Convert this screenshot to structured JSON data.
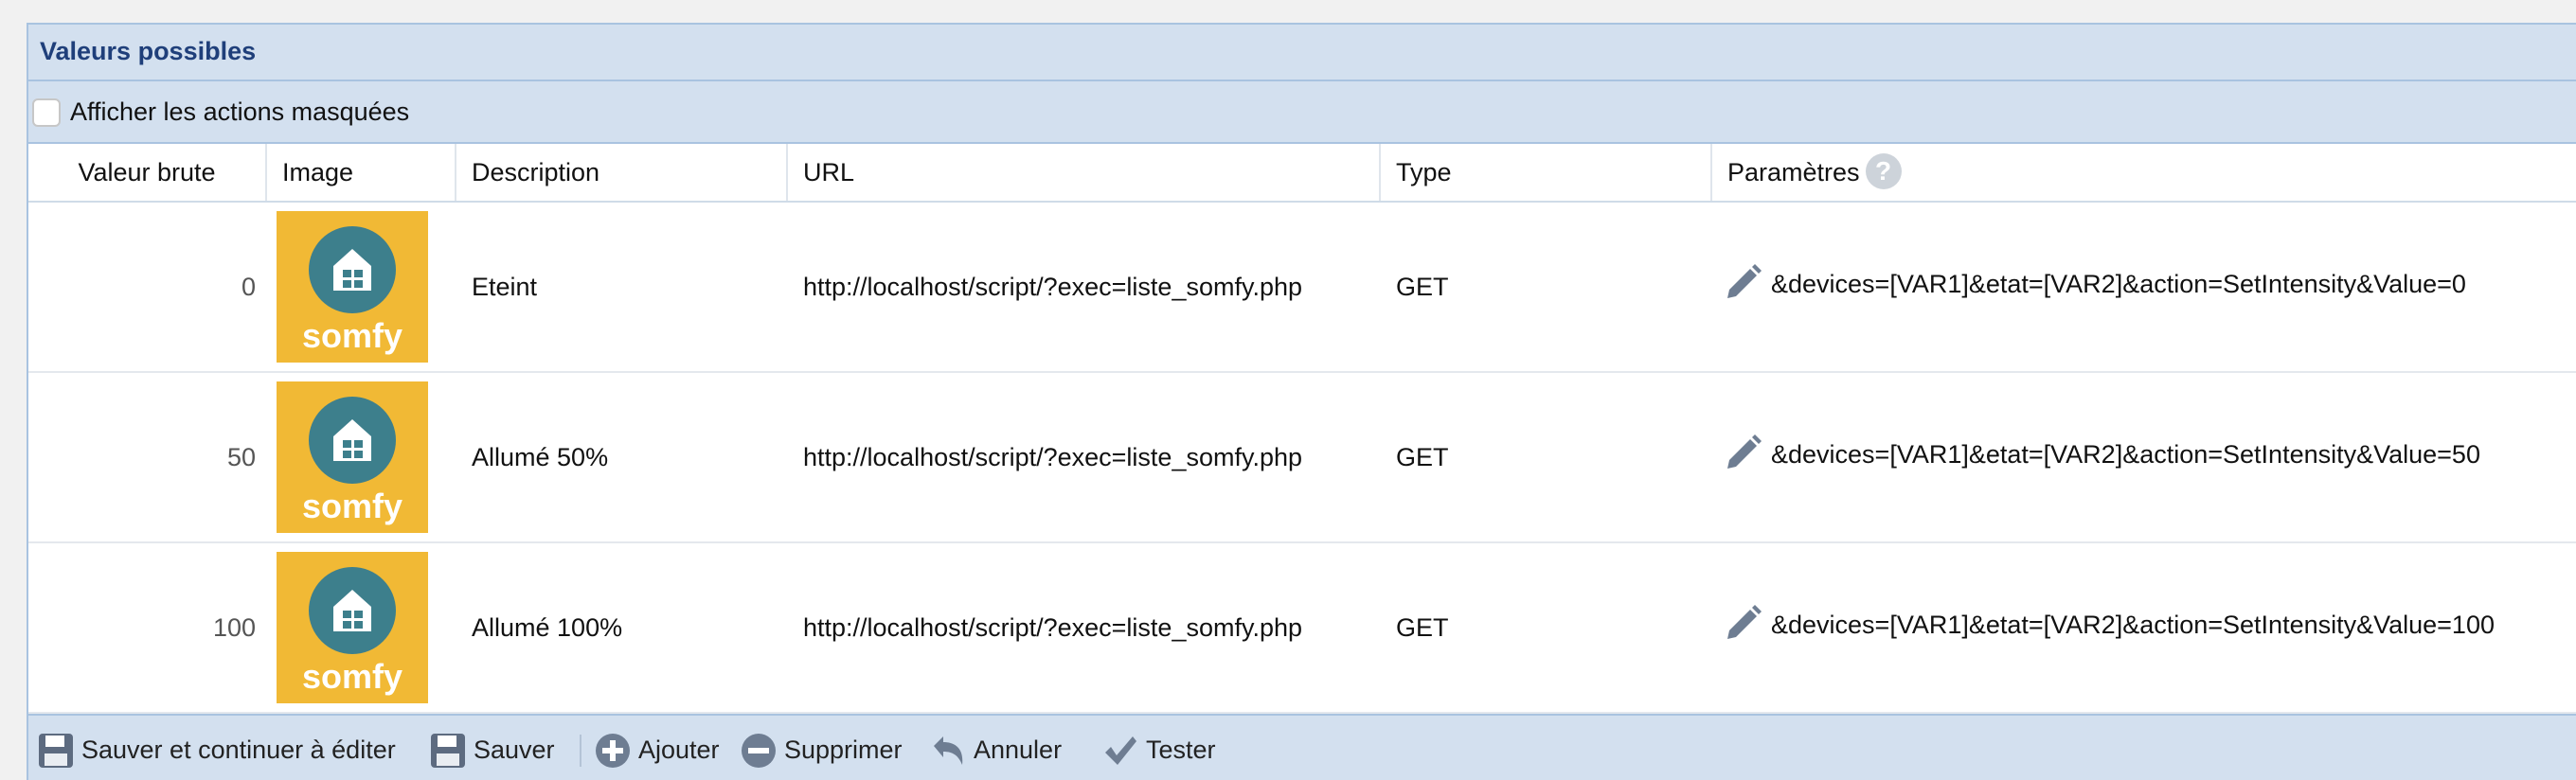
{
  "panel": {
    "title": "Valeurs possibles"
  },
  "filter": {
    "show_masked_label": "Afficher les actions masquées",
    "checked": false
  },
  "table": {
    "headers": {
      "raw": "Valeur brute",
      "image": "Image",
      "description": "Description",
      "url": "URL",
      "type": "Type",
      "params": "Paramètres"
    },
    "help_icon": "?",
    "rows": [
      {
        "raw": "0",
        "image_text": "somfy",
        "description": "Eteint",
        "url": "http://localhost/script/?exec=liste_somfy.php",
        "type": "GET",
        "params": "&devices=[VAR1]&etat=[VAR2]&action=SetIntensity&Value=0"
      },
      {
        "raw": "50",
        "image_text": "somfy",
        "description": "Allumé 50%",
        "url": "http://localhost/script/?exec=liste_somfy.php",
        "type": "GET",
        "params": "&devices=[VAR1]&etat=[VAR2]&action=SetIntensity&Value=50"
      },
      {
        "raw": "100",
        "image_text": "somfy",
        "description": "Allumé 100%",
        "url": "http://localhost/script/?exec=liste_somfy.php",
        "type": "GET",
        "params": "&devices=[VAR1]&etat=[VAR2]&action=SetIntensity&Value=100"
      }
    ]
  },
  "toolbar": {
    "save_continue": "Sauver et continuer à éditer",
    "save": "Sauver",
    "add": "Ajouter",
    "delete": "Supprimer",
    "cancel": "Annuler",
    "test": "Tester"
  },
  "colors": {
    "header_bg": "#d3e0ef",
    "title": "#1f3f7a",
    "somfy_bg": "#f1b935",
    "somfy_teal": "#3d7f8c"
  },
  "icons": [
    "help-icon",
    "edit-pencil-icon",
    "floppy-disk-icon",
    "plus-circle-icon",
    "minus-circle-icon",
    "undo-arrow-icon",
    "checkmark-icon"
  ]
}
